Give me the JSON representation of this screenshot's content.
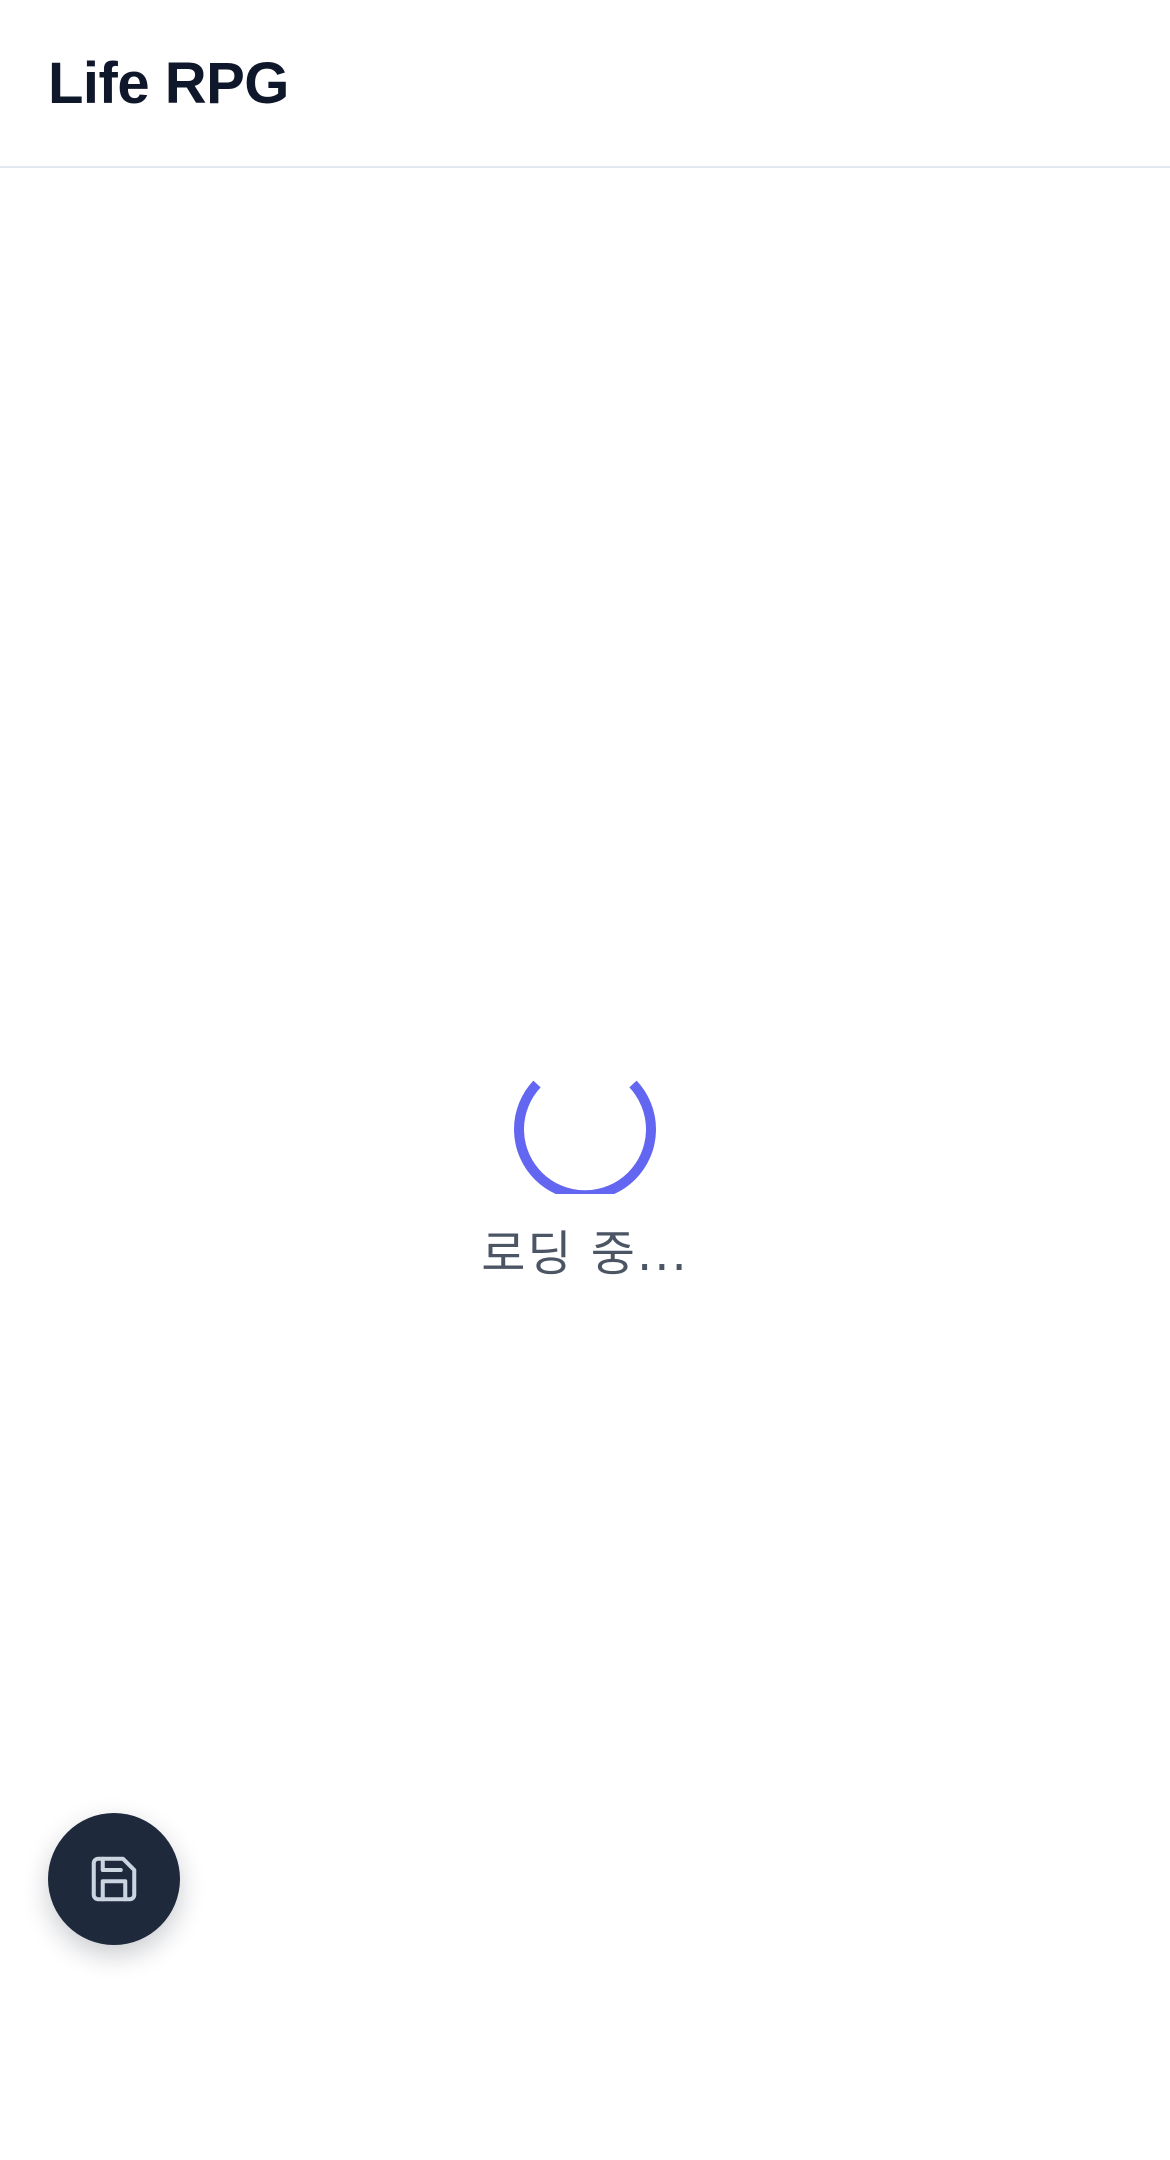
{
  "header": {
    "title": "Life RPG"
  },
  "loading": {
    "text": "로딩 중...",
    "spinner_color": "#6366f1"
  },
  "fab": {
    "icon": "save-icon",
    "background_color": "#1e293b",
    "icon_color": "#cbd5e1"
  },
  "colors": {
    "header_border": "#e2e8f0",
    "title_text": "#0f172a",
    "loading_text": "#4b5563"
  }
}
